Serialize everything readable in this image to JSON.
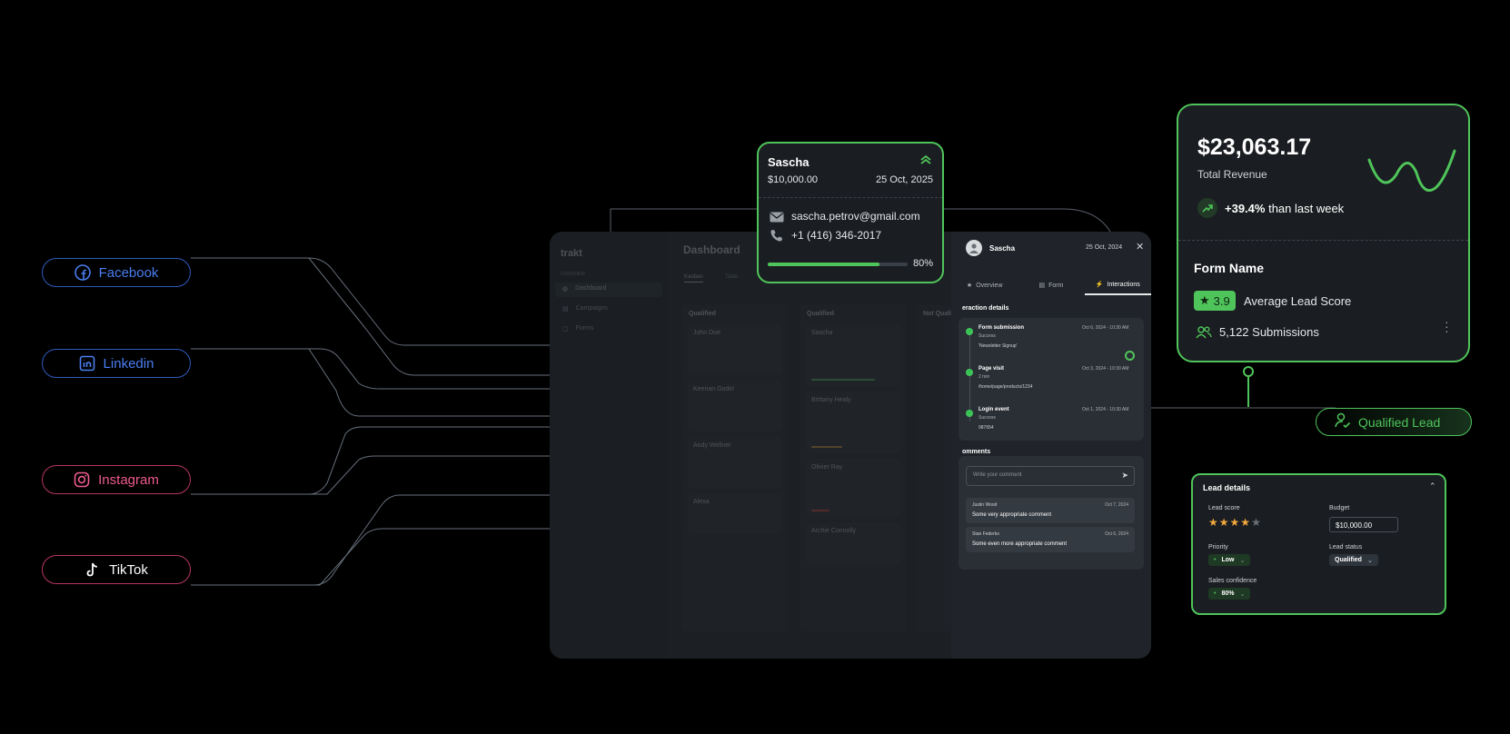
{
  "sources": [
    {
      "label": "Facebook",
      "icon": "facebook-icon",
      "color": "#3b6fe0"
    },
    {
      "label": "Linkedin",
      "icon": "linkedin-icon",
      "color": "#3b6fe0"
    },
    {
      "label": "Instagram",
      "icon": "instagram-icon",
      "color": "#e0457a"
    },
    {
      "label": "TikTok",
      "icon": "tiktok-icon",
      "color": "#e0457a"
    }
  ],
  "dashboard": {
    "logo": "trakt",
    "title": "Dashboard",
    "sidebar_section": "OVERVIEW",
    "sidebar_items": [
      "Dashboard",
      "Campaigns",
      "Forms"
    ],
    "view_tabs": [
      "Kanban",
      "Table"
    ],
    "columns": [
      "Qualified",
      "Qualified",
      "Not Quali"
    ],
    "cards": {
      "col1": [
        "John Doe",
        "Keenan Godel",
        "Andy Wellner",
        "Alexa"
      ],
      "col2": [
        "Sascha",
        "Brittany Healy",
        "Olivier Ray",
        "Archie Connolly"
      ]
    }
  },
  "lead_popup": {
    "name": "Sascha",
    "amount": "$10,000.00",
    "date": "25 Oct, 2025",
    "email": "sascha.petrov@gmail.com",
    "phone": "+1 (416) 346-2017",
    "progress_label": "80%",
    "progress_value": 0.8
  },
  "detail_panel": {
    "name": "Sascha",
    "date": "25 Oct, 2024",
    "tabs": [
      "Overview",
      "Form",
      "Interactions"
    ],
    "interaction_heading": "eraction details",
    "interactions": [
      {
        "title": "Form submission",
        "sub": "Success",
        "extra": "'Newsletter Signup'",
        "date": "Oct 6, 2024 - 10:30 AM"
      },
      {
        "title": "Page visit",
        "sub": "2 min",
        "extra": "/home/page/products/1234",
        "date": "Oct 3, 2024 - 10:30 AM"
      },
      {
        "title": "Login event",
        "sub": "Success",
        "extra": "987654",
        "date": "Oct 1, 2024 - 10:30 AM"
      }
    ],
    "comments_heading": "omments",
    "comment_placeholder": "Write your comment",
    "comments": [
      {
        "author": "Justin Wood",
        "date": "Oct 7, 2024",
        "text": "Some very appropriate comment"
      },
      {
        "author": "Stan Federko",
        "date": "Oct 6, 2024",
        "text": "Some even more appropriate comment"
      }
    ]
  },
  "revenue_card": {
    "amount": "$23,063.17",
    "label": "Total Revenue",
    "change": "+39.4%",
    "change_suffix": "than last week",
    "form_name": "Form Name",
    "score": "3.9",
    "score_label": "Average Lead Score",
    "submissions": "5,122 Submissions"
  },
  "qualified_tag": {
    "label": "Qualified Lead"
  },
  "lead_details": {
    "title": "Lead details",
    "lead_score_label": "Lead score",
    "stars_filled": 4,
    "stars_total": 5,
    "budget_label": "Budget",
    "budget_value": "$10,000.00",
    "priority_label": "Priority",
    "priority_value": "Low",
    "status_label": "Lead status",
    "status_value": "Qualified",
    "confidence_label": "Sales confidence",
    "confidence_value": "80%"
  },
  "colors": {
    "accent": "#4fc45a",
    "blue": "#3b6fe0",
    "pink": "#e0457a",
    "cyan": "#3fc6e0"
  }
}
